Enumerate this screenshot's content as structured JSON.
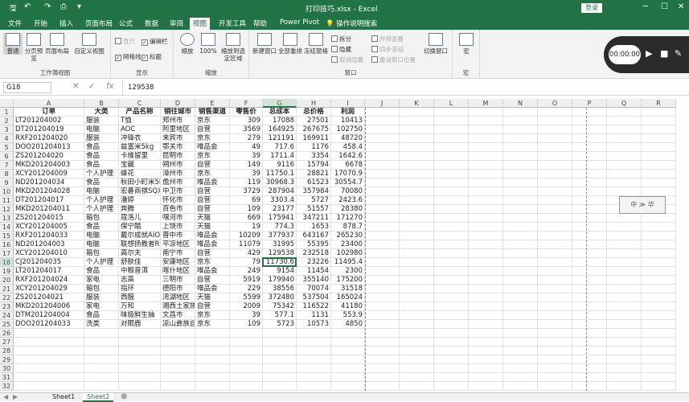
{
  "titlebar": {
    "title": "打印技巧.xlsx - Excel",
    "login": "登录",
    "save_icon": "save-icon",
    "undo_icon": "undo-icon",
    "redo_icon": "redo-icon"
  },
  "tabs": [
    "文件",
    "开始",
    "插入",
    "页面布局",
    "公式",
    "数据",
    "审阅",
    "视图",
    "开发工具",
    "帮助",
    "Power Pivot"
  ],
  "active_tab": "视图",
  "tellme": "操作说明搜索",
  "ribbon": {
    "workbook_views": {
      "label": "工作簿视图",
      "normal": "普通",
      "page_break": "分页预览",
      "page_layout": "页面布局",
      "custom": "自定义视图"
    },
    "show": {
      "label": "显示",
      "ruler": "直尺",
      "formula_bar": "编辑栏",
      "gridlines": "网格线",
      "headings": "标题"
    },
    "zoom": {
      "label": "缩放",
      "zoom": "缩放",
      "hundred": "100%",
      "to_selection": "缩放到选定区域"
    },
    "window": {
      "label": "窗口",
      "new_window": "新建窗口",
      "arrange_all": "全部重排",
      "freeze": "冻结窗格",
      "split": "拆分",
      "hide": "隐藏",
      "unhide": "取消隐藏",
      "side_by_side": "并排查看",
      "sync_scroll": "同步滚动",
      "reset_pos": "重设窗口位置",
      "switch": "切换窗口"
    },
    "macros": {
      "label": "宏",
      "macro": "宏"
    }
  },
  "recorder": {
    "time": "00:00:00"
  },
  "formula_bar": {
    "name_box": "G18",
    "content": "129538"
  },
  "columns": [
    "A",
    "B",
    "C",
    "D",
    "E",
    "F",
    "G",
    "H",
    "I",
    "J",
    "K",
    "L",
    "M",
    "N",
    "O",
    "P",
    "Q",
    "R"
  ],
  "headers": [
    "订单",
    "大类",
    "产品名称",
    "销往城市",
    "销售渠道",
    "零售价",
    "总成本",
    "总价格",
    "利润"
  ],
  "rows": [
    [
      "LT201204002",
      "服装",
      "T恤",
      "郑州市",
      "京东",
      "309",
      "17088",
      "27501",
      "10413"
    ],
    [
      "DT201204019",
      "电脑",
      "AOC",
      "阿里地区",
      "自营",
      "3569",
      "164925",
      "267675",
      "102750"
    ],
    [
      "RXF201204020",
      "服装",
      "冲锋衣",
      "来宾市",
      "京东",
      "279",
      "121191",
      "169911",
      "48720"
    ],
    [
      "DOO201204013",
      "食品",
      "兹富米5kg",
      "鄂关市",
      "唯品会",
      "49",
      "717.6",
      "1176",
      "458.4"
    ],
    [
      "ZS201204020",
      "食品",
      "卡维留里",
      "昆明市",
      "京东",
      "39",
      "1711.4",
      "3354",
      "1642.6"
    ],
    [
      "MKD201204003",
      "食品",
      "宝藏",
      "朔州市",
      "自营",
      "149",
      "9116",
      "15794",
      "6678"
    ],
    [
      "XCY201204009",
      "个人护理",
      "蜂花",
      "漳州市",
      "京东",
      "39",
      "11750.1",
      "28821",
      "17070.9"
    ],
    [
      "ND201204034",
      "食品",
      "秋田小町米5kg",
      "儋州市",
      "唯品会",
      "119",
      "30968.3",
      "61523",
      "30554.7"
    ],
    [
      "MKD201204028",
      "电脑",
      "宏碁商祺SQX46",
      "中卫市",
      "自营",
      "3729",
      "287904",
      "357984",
      "70080"
    ],
    [
      "DT201204017",
      "个人护理",
      "潘婷",
      "怀化市",
      "自营",
      "69",
      "3303.4",
      "5727",
      "2423.6"
    ],
    [
      "MKD201204011",
      "个人护理",
      "奔腾",
      "百色市",
      "自营",
      "109",
      "23177",
      "51557",
      "28380"
    ],
    [
      "ZS201204015",
      "箱包",
      "蔻洛儿",
      "嘿河市",
      "天猫",
      "669",
      "175941",
      "347211",
      "171270"
    ],
    [
      "XCY201204005",
      "食品",
      "保宁醋",
      "上饶市",
      "天猫",
      "19",
      "774.3",
      "1653",
      "878.7"
    ],
    [
      "RXF201204033",
      "电脑",
      "戴尔成就AIO",
      "晋中市",
      "唯品会",
      "10209",
      "377937",
      "643167",
      "265230"
    ],
    [
      "ND201204003",
      "电脑",
      "联想扬教者R72",
      "平凉地区",
      "唯品会",
      "11079",
      "31995",
      "55395",
      "23400"
    ],
    [
      "XCY201204010",
      "箱包",
      "高尔夫",
      "南宁市",
      "自营",
      "429",
      "129538",
      "232518",
      "102980"
    ],
    [
      "CJ201204035",
      "个人护理",
      "舒肤佳",
      "安康地区",
      "京东",
      "79",
      "11730.6",
      "23226",
      "11495.4"
    ],
    [
      "LT201204017",
      "食品",
      "中粮普洱",
      "喀什地区",
      "唯品会",
      "249",
      "9154",
      "11454",
      "2300"
    ],
    [
      "RXF201204024",
      "家电",
      "志高",
      "三明市",
      "自营",
      "5919",
      "179940",
      "355140",
      "175200"
    ],
    [
      "XCY201204029",
      "箱包",
      "指环",
      "德阳市",
      "唯品会",
      "229",
      "38556",
      "70074",
      "31518"
    ],
    [
      "ZS201204021",
      "服装",
      "西服",
      "湾湖地区",
      "天猫",
      "5599",
      "372480",
      "537504",
      "165024"
    ],
    [
      "MKD201204006",
      "家电",
      "万和",
      "湘西土家族",
      "自营",
      "2009",
      "75342",
      "116522",
      "41180"
    ],
    [
      "DTM201204004",
      "食品",
      "味极鲜生抽",
      "文昌市",
      "京东",
      "39",
      "577.1",
      "1131",
      "553.9"
    ],
    [
      "DOO201204033",
      "洗类",
      "对眼鹿",
      "凉山彝族自",
      "京东",
      "109",
      "5723",
      "10573",
      "4850"
    ]
  ],
  "selected_cell": "G18",
  "stamp": "中 ≫ 华",
  "sheets": [
    "Sheet1",
    "Sheet2"
  ],
  "active_sheet": "Sheet2"
}
